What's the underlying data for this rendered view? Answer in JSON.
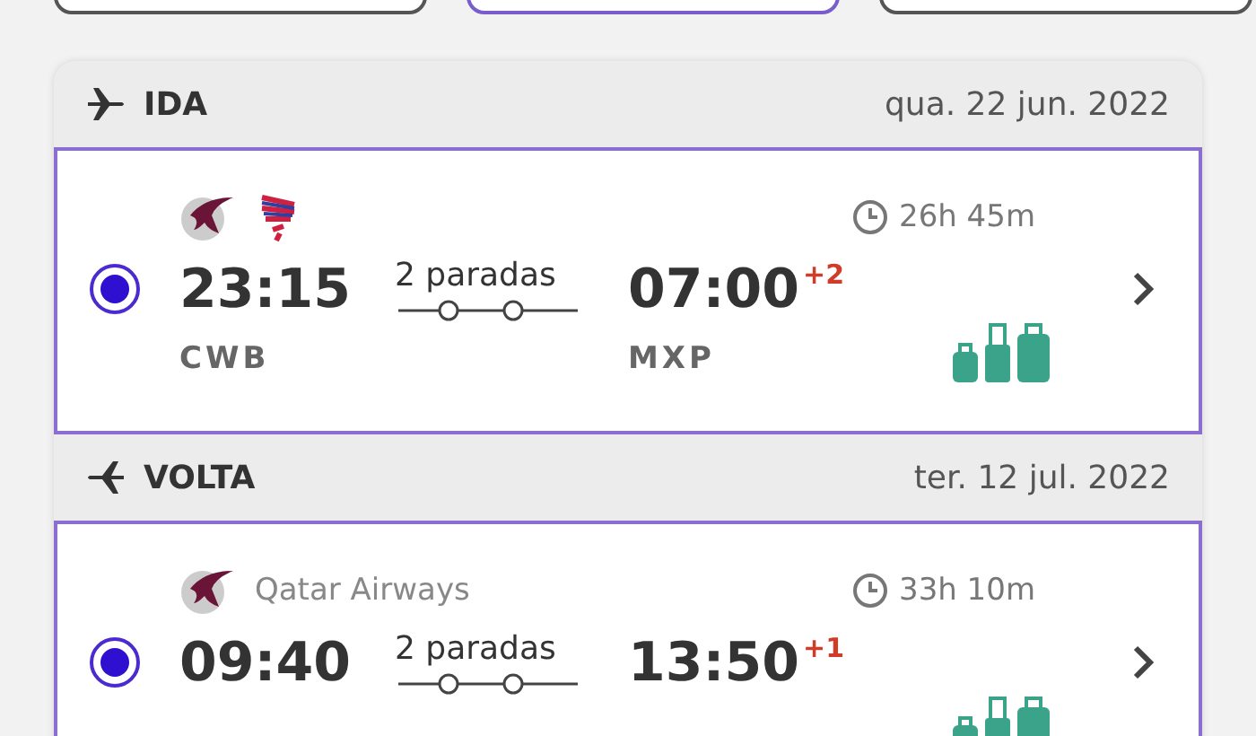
{
  "filter_buttons": [
    {
      "selected": false
    },
    {
      "selected": true
    },
    {
      "selected": false
    }
  ],
  "legs": [
    {
      "kind": "outbound",
      "label": "IDA",
      "date": "qua. 22 jun. 2022",
      "flight": {
        "selected": true,
        "airline_logos": [
          {
            "kind": "bird"
          },
          {
            "kind": "stripes"
          }
        ],
        "duration": "26h 45m",
        "departure_time": "23:15",
        "departure_code": "CWB",
        "stops": "2 paradas",
        "arrival_time": "07:00",
        "day_offset": "+2",
        "arrival_code": "MXP"
      }
    },
    {
      "kind": "return",
      "label": "VOLTA",
      "date": "ter. 12 jul. 2022",
      "flight": {
        "selected": true,
        "airline_logos": [
          {
            "kind": "bird"
          }
        ],
        "airline": "Qatar Airways",
        "duration": "33h 10m",
        "departure_time": "09:40",
        "stops": "2 paradas",
        "arrival_time": "13:50",
        "day_offset": "+1"
      }
    }
  ]
}
